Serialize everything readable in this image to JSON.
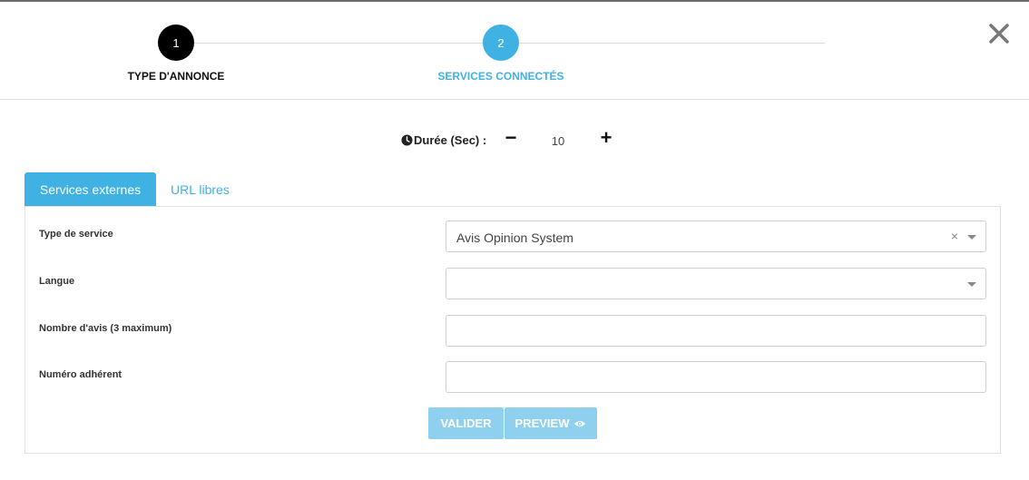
{
  "stepper": {
    "steps": [
      {
        "number": "1",
        "label": "TYPE D'ANNONCE",
        "state": "done"
      },
      {
        "number": "2",
        "label": "SERVICES CONNECTÉS",
        "state": "active"
      }
    ]
  },
  "duration": {
    "label": "Durée (Sec) :",
    "value": "10",
    "minus": "−",
    "plus": "+"
  },
  "tabs": [
    {
      "label": "Services externes",
      "active": true
    },
    {
      "label": "URL libres",
      "active": false
    }
  ],
  "form": {
    "fields": [
      {
        "label": "Type de service",
        "value": "Avis Opinion System",
        "kind": "select"
      },
      {
        "label": "Langue",
        "value": "",
        "kind": "select"
      },
      {
        "label": "Nombre d'avis (3 maximum)",
        "value": "",
        "kind": "text"
      },
      {
        "label": "Numéro adhérent",
        "value": "",
        "kind": "text"
      }
    ],
    "clear_glyph": "×"
  },
  "buttons": {
    "valider": "VALIDER",
    "preview": "PREVIEW"
  },
  "colors": {
    "accent": "#3fb2e3",
    "button_disabled": "#8fd0ee",
    "step_done": "#000000"
  }
}
